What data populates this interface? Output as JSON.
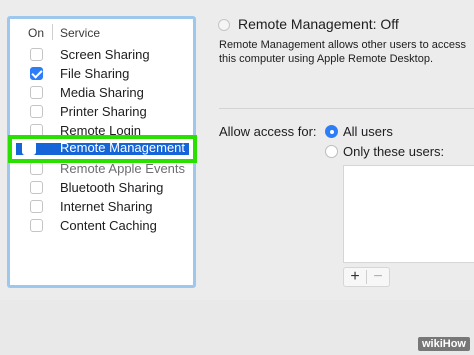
{
  "services": {
    "header_on": "On",
    "header_service": "Service",
    "items": [
      {
        "label": "Screen Sharing",
        "checked": false
      },
      {
        "label": "File Sharing",
        "checked": true
      },
      {
        "label": "Media Sharing",
        "checked": false
      },
      {
        "label": "Printer Sharing",
        "checked": false
      },
      {
        "label": "Remote Login",
        "checked": false
      },
      {
        "label": "Remote Management",
        "checked": false,
        "selected": true
      },
      {
        "label": "Remote Apple Events",
        "checked": false
      },
      {
        "label": "Bluetooth Sharing",
        "checked": false
      },
      {
        "label": "Internet Sharing",
        "checked": false
      },
      {
        "label": "Content Caching",
        "checked": false
      }
    ]
  },
  "detail": {
    "status_title": "Remote Management: Off",
    "description": "Remote Management allows other users to access this computer using Apple Remote Desktop.",
    "allow_access_label": "Allow access for:",
    "option_all": "All users",
    "option_only": "Only these users:",
    "selected_option": "all",
    "add_button": "+",
    "remove_button": "−"
  },
  "watermark": "wikiHow",
  "colors": {
    "accent": "#2d7df6",
    "selection": "#1565d8",
    "highlight": "#29e000",
    "panel_border": "#9ec7ee"
  }
}
